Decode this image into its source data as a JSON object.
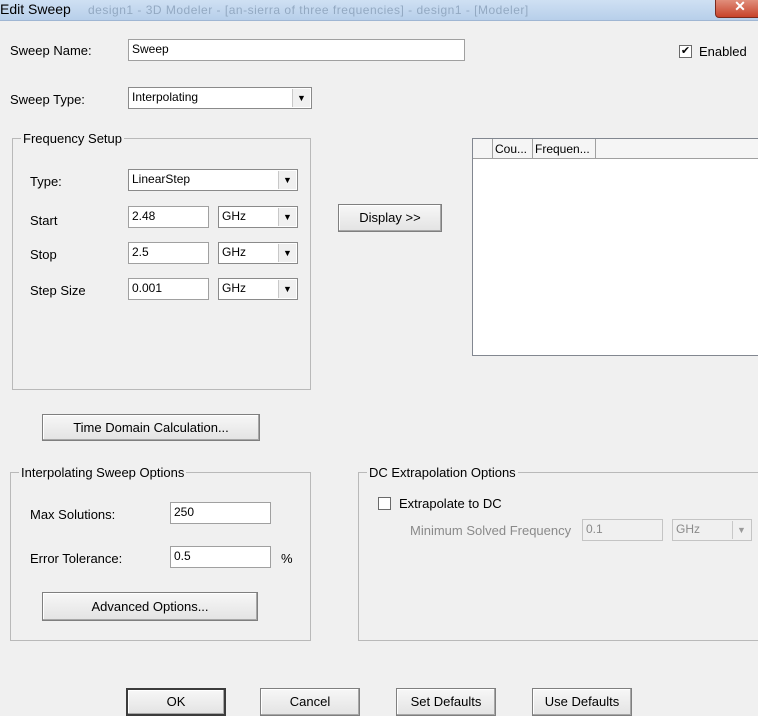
{
  "window": {
    "title": "Edit Sweep",
    "background_title": "design1 - 3D Modeler - [an-sierra of three frequencies] - design1 - [Modeler]",
    "close_glyph": "✕"
  },
  "sweep_name": {
    "label": "Sweep Name:",
    "value": "Sweep"
  },
  "enabled": {
    "label": "Enabled",
    "checked": true
  },
  "sweep_type": {
    "label": "Sweep Type:",
    "value": "Interpolating"
  },
  "frequency_setup": {
    "title": "Frequency Setup",
    "type": {
      "label": "Type:",
      "value": "LinearStep"
    },
    "start": {
      "label": "Start",
      "value": "2.48",
      "unit": "GHz"
    },
    "stop": {
      "label": "Stop",
      "value": "2.5",
      "unit": "GHz"
    },
    "step_size": {
      "label": "Step Size",
      "value": "0.001",
      "unit": "GHz"
    }
  },
  "display_button": "Display >>",
  "table": {
    "columns": [
      "",
      "Cou...",
      "Frequen..."
    ]
  },
  "time_domain_button": "Time Domain Calculation...",
  "interp_options": {
    "title": "Interpolating Sweep Options",
    "max_solutions": {
      "label": "Max Solutions:",
      "value": "250"
    },
    "error_tolerance": {
      "label": "Error Tolerance:",
      "value": "0.5",
      "unit": "%"
    },
    "advanced_button": "Advanced Options..."
  },
  "dc_options": {
    "title": "DC Extrapolation Options",
    "extrapolate": {
      "label": "Extrapolate to DC",
      "checked": false
    },
    "min_freq": {
      "label": "Minimum Solved Frequency",
      "value": "0.1",
      "unit": "GHz"
    }
  },
  "buttons": {
    "ok": "OK",
    "cancel": "Cancel",
    "set_defaults": "Set Defaults",
    "use_defaults": "Use Defaults"
  },
  "icons": {
    "dropdown": "▼",
    "check": "✔"
  }
}
